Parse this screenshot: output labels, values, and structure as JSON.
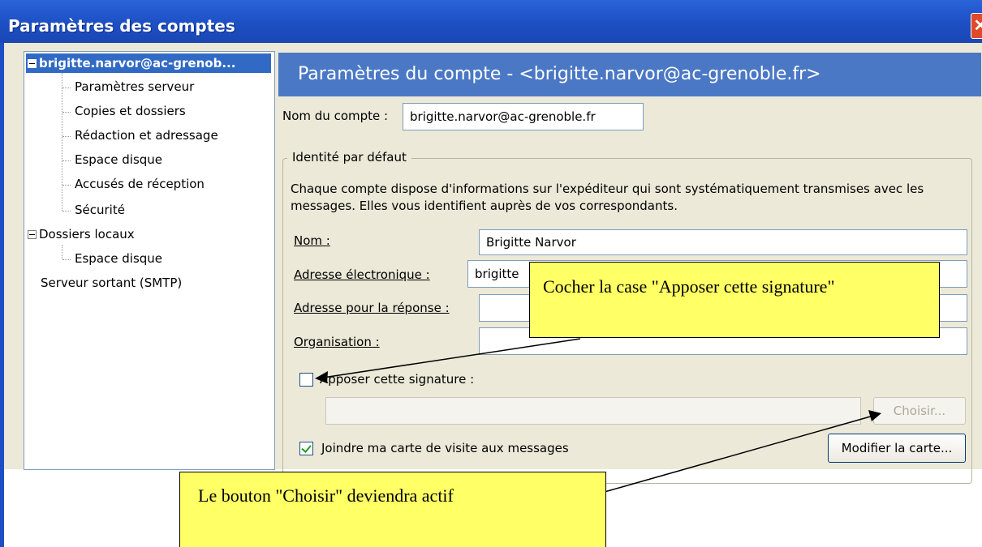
{
  "window": {
    "title": "Paramètres des comptes",
    "close_glyph": "✕"
  },
  "tree": {
    "account": "brigitte.narvor@ac-grenob...",
    "account_children": [
      "Paramètres serveur",
      "Copies et dossiers",
      "Rédaction et adressage",
      "Espace disque",
      "Accusés de réception",
      "Sécurité"
    ],
    "local": "Dossiers locaux",
    "local_children": [
      "Espace disque"
    ],
    "smtp": "Serveur sortant (SMTP)"
  },
  "panel": {
    "header": "Paramètres du compte - <brigitte.narvor@ac-grenoble.fr>",
    "account_name_label": "Nom du compte :",
    "account_name_value": "brigitte.narvor@ac-grenoble.fr",
    "identity_group": "Identité par défaut",
    "identity_desc": "Chaque compte dispose d'informations sur l'expéditeur qui sont systématiquement transmises avec les messages. Elles vous identifient auprès de vos correspondants.",
    "name_label": "Nom :",
    "name_value": "Brigitte Narvor",
    "email_label": "Adresse électronique :",
    "email_value": "brigitte",
    "reply_label": "Adresse pour la réponse :",
    "reply_value": "",
    "org_label": "Organisation :",
    "org_value": "",
    "signature_label": "Apposer cette signature :",
    "signature_checked": false,
    "signature_path": "",
    "choose_button": "Choisir...",
    "vcard_label": "Joindre ma carte de visite aux messages",
    "vcard_checked": true,
    "edit_card_button": "Modifier la carte..."
  },
  "callouts": {
    "checkbox_hint": "Cocher la case \"Apposer cette signature\"",
    "button_hint": "Le bouton \"Choisir\" deviendra actif"
  },
  "colors": {
    "titlebar": "#1d4fc4",
    "header": "#4a78c5",
    "selection": "#316ac5",
    "callout": "#ffff66",
    "dialog_bg": "#ece9d8"
  }
}
